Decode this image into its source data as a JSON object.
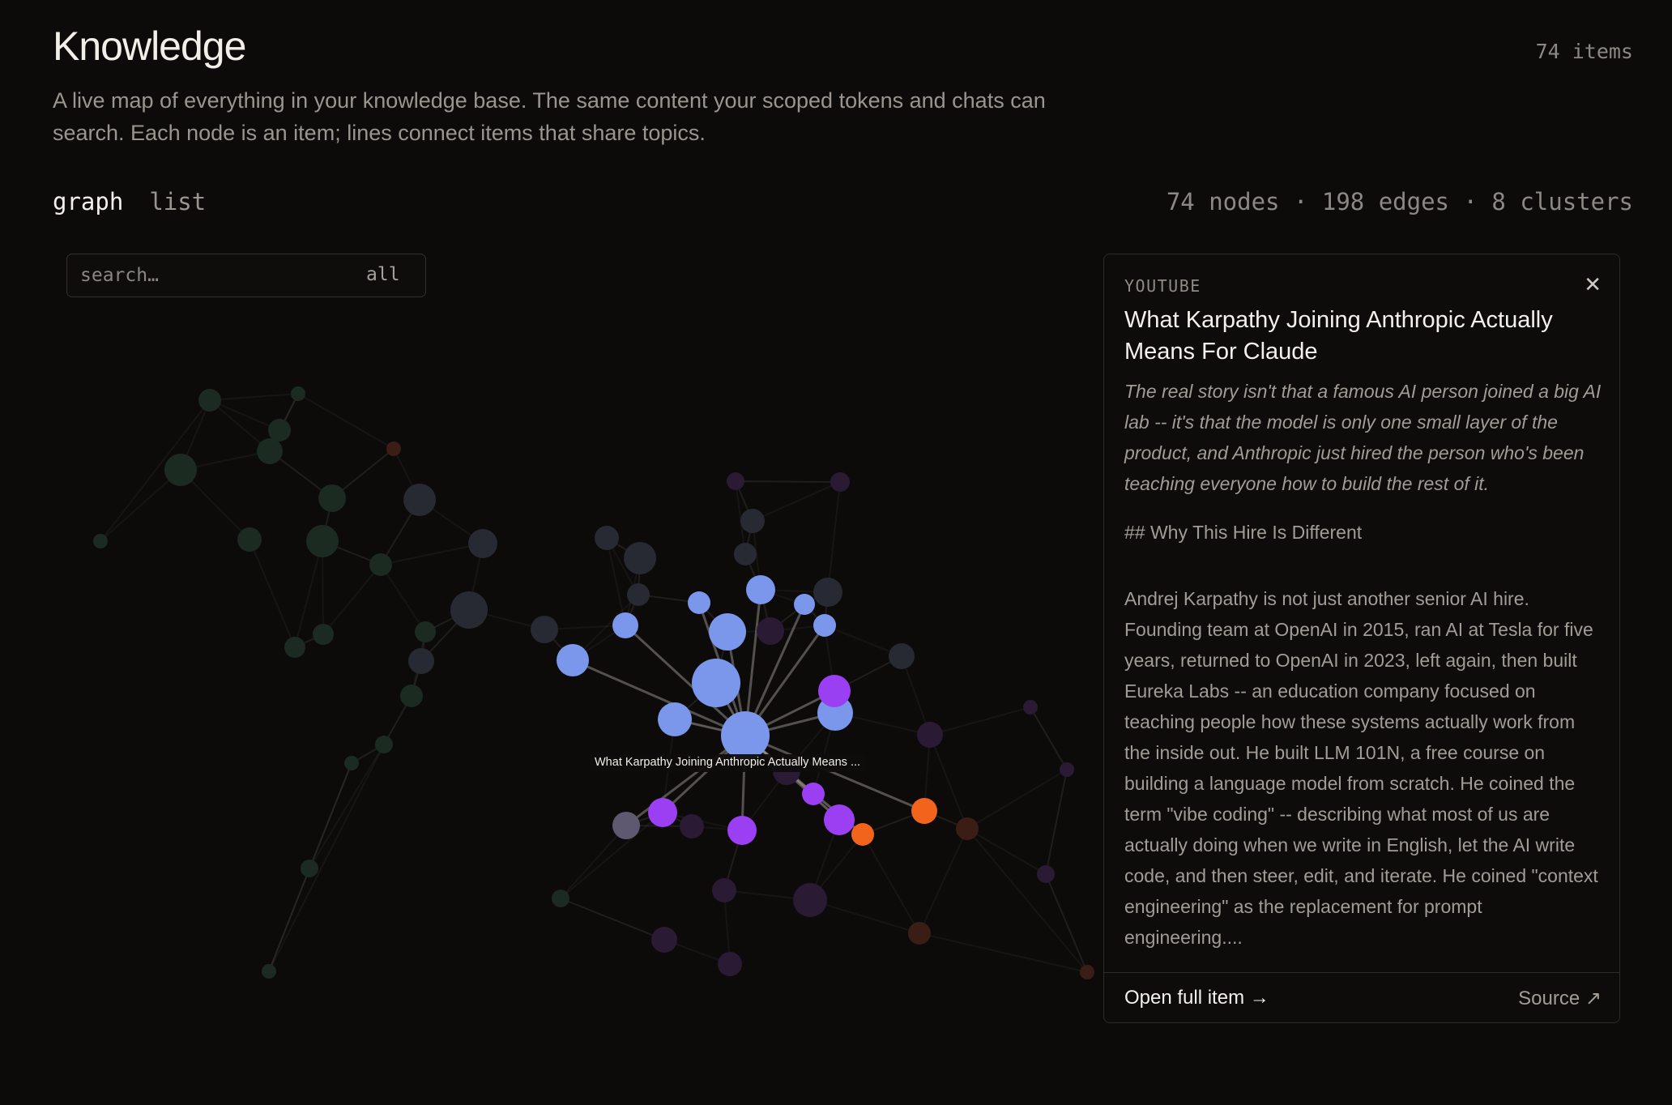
{
  "header": {
    "title": "Knowledge",
    "item_count": "74 items",
    "subtitle": "A live map of everything in your knowledge base. The same content your scoped tokens and chats can search. Each node is an item; lines connect items that share topics."
  },
  "view_tabs": {
    "graph": "graph",
    "list": "list",
    "active": "graph"
  },
  "graph_stats": "74 nodes · 198 edges · 8 clusters",
  "search": {
    "placeholder": "search…",
    "filter_label": "all"
  },
  "graph": {
    "hover_label": "What Karpathy Joining Anthropic Actually Means ...",
    "cluster_colors": {
      "active_primary": "#7b97ec",
      "active_secondary": "#9b3ff2",
      "active_accent": "#f2641c",
      "active_neutral": "#5e5970",
      "dim_green": "#1b2b21",
      "dim_slate": "#272a33",
      "dim_purple": "#2a1a33",
      "dim_rust": "#3a1e16"
    }
  },
  "detail": {
    "source_type": "YOUTUBE",
    "close_icon": "close-icon",
    "title": "What Karpathy Joining Anthropic Actually Means For Claude",
    "summary": "The real story isn't that a famous AI person joined a big AI lab -- it's that the model is only one small layer of the product, and Anthropic just hired the person who's been teaching everyone how to build the rest of it.",
    "heading": "## Why This Hire Is Different",
    "body": "Andrej Karpathy is not just another senior AI hire. Founding team at OpenAI in 2015, ran AI at Tesla for five years, returned to OpenAI in 2023, left again, then built Eureka Labs -- an education company focused on teaching people how these systems actually work from the inside out. He built LLM 101N, a free course on building a language model from scratch. He coined the term \"vibe coding\" -- describing what most of us are actually doing when we write in English, let the AI write code, and then steer, edit, and iterate. He coined \"context engineering\" as the replacement for prompt engineering....",
    "open_full_label": "Open full item →",
    "source_label": "Source ↗"
  }
}
